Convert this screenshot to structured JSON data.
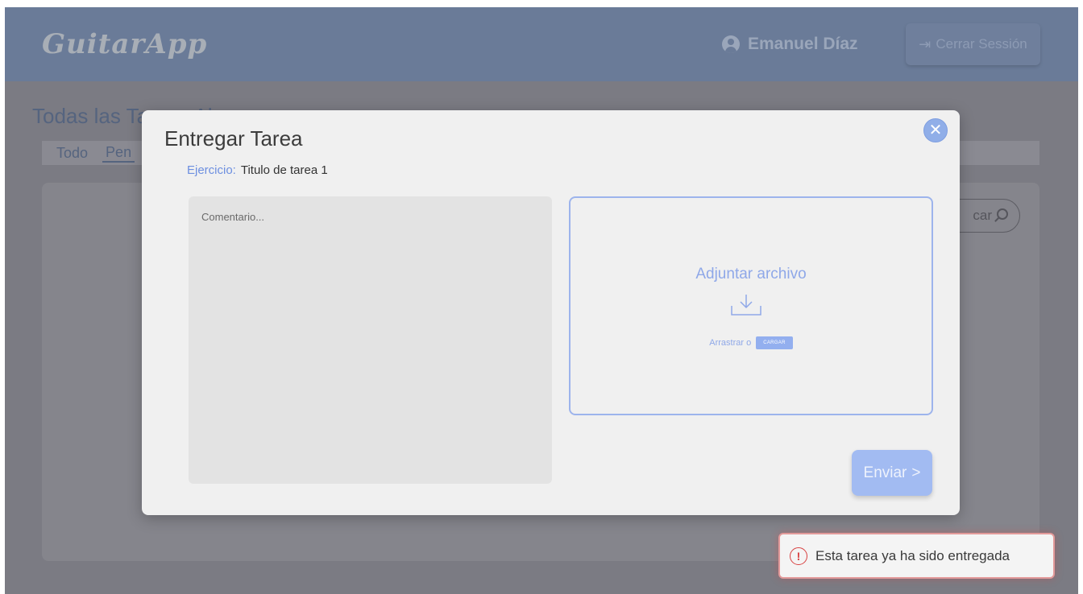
{
  "app": {
    "logo": "GuitarApp"
  },
  "header": {
    "user_name": "Emanuel Díaz",
    "logout_label": "Cerrar Sessión",
    "logout_icon": "logout-icon",
    "user_icon": "user-circle-icon"
  },
  "background": {
    "page_title": "Todas las Tareas Al",
    "tabs": [
      "Todo",
      "Pen"
    ],
    "search_placeholder": "car"
  },
  "modal": {
    "title": "Entregar Tarea",
    "exercise_label": "Ejercicio:",
    "exercise_value": "Titulo de tarea 1",
    "comment_placeholder": "Comentario...",
    "dropzone_title": "Adjuntar archivo",
    "dropzone_drag_text": "Arrastrar o",
    "upload_button": "CARGAR",
    "send_button": "Enviar",
    "close_icon": "close-icon"
  },
  "toast": {
    "message": "Esta tarea ya ha sido entregada",
    "icon": "alert-circle-icon"
  },
  "colors": {
    "accent": "#8fa8e8",
    "header_bg": "#6a7b98",
    "error": "#d84040"
  }
}
